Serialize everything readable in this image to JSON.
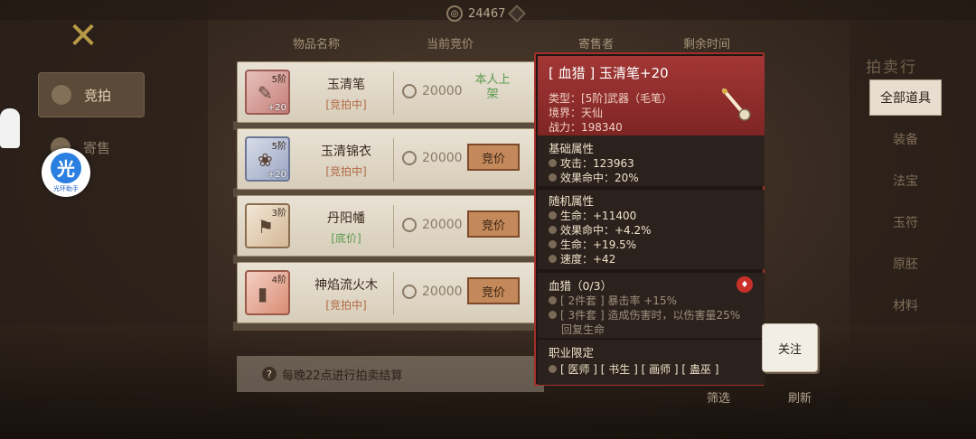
{
  "top": {
    "currency_amount": "24467"
  },
  "left_tabs": [
    {
      "label": "竞拍",
      "active": true
    },
    {
      "label": "寄售",
      "active": false
    }
  ],
  "helper": {
    "glyph": "光",
    "label": "光环助手"
  },
  "columns": {
    "name": "物品名称",
    "price": "当前竞价",
    "seller": "寄售者",
    "time": "剩余时间"
  },
  "rows": [
    {
      "name": "玉清笔",
      "status": "[竞拍中]",
      "tier": "5阶",
      "plus": "+20",
      "price": "20000",
      "seller": "本人上架",
      "action": ""
    },
    {
      "name": "玉清锦衣",
      "status": "[竞拍中]",
      "tier": "5阶",
      "plus": "+20",
      "price": "20000",
      "seller": "",
      "action": "竞价"
    },
    {
      "name": "丹阳幡",
      "status": "[底价]",
      "tier": "3阶",
      "plus": "",
      "price": "20000",
      "seller": "",
      "action": "竞价"
    },
    {
      "name": "神焰流火木",
      "status": "[竞拍中]",
      "tier": "4阶",
      "plus": "",
      "price": "20000",
      "seller": "",
      "action": "竞价"
    }
  ],
  "notice": "每晚22点进行拍卖结算",
  "tooltip": {
    "title": "[ 血猎 ] 玉清笔+20",
    "type_line": "类型：[5阶]武器（毛笔）",
    "realm_line": "境界：天仙",
    "power_line": "战力：198340",
    "base_title": "基础属性",
    "base": [
      "攻击：123963",
      "效果命中：20%"
    ],
    "random_title": "随机属性",
    "random": [
      "生命：+11400",
      "效果命中：+4.2%",
      "生命：+19.5%",
      "速度：+42"
    ],
    "set_title": "血猎（0/3）",
    "set_2": "[ 2件套 ] 暴击率 +15%",
    "set_3a": "[ 3件套 ] 造成伤害时，以伤害量25%",
    "set_3b": "回复生命",
    "class_title": "职业限定",
    "class_line": "[ 医师 ] [ 书生 ] [ 画师 ] [ 蛊巫 ]"
  },
  "follow_label": "关注",
  "right_panel": {
    "title": "拍卖行",
    "categories": [
      "全部道具",
      "装备",
      "法宝",
      "玉符",
      "原胚",
      "材料"
    ]
  },
  "bottom": {
    "filter": "筛选",
    "refresh": "刷新"
  }
}
